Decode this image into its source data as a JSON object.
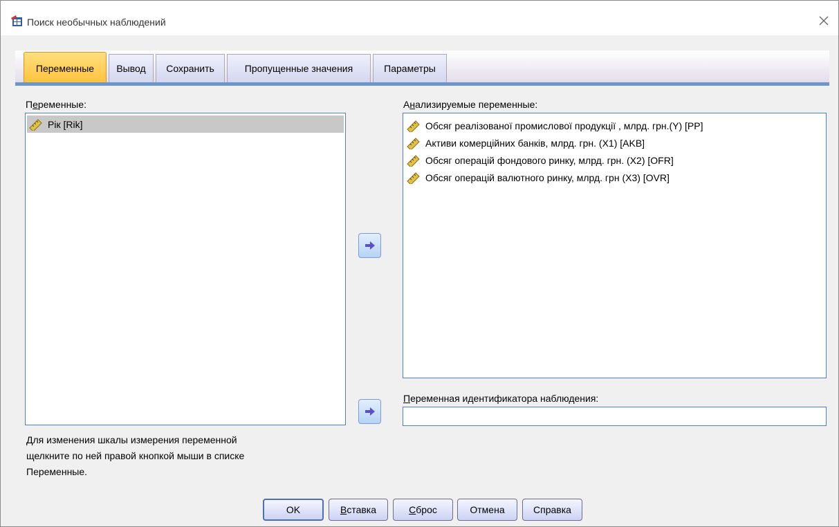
{
  "window": {
    "title": "Поиск необычных наблюдений"
  },
  "tabs": [
    {
      "label": "Переменные",
      "active": true
    },
    {
      "label": "Вывод"
    },
    {
      "label": "Сохранить"
    },
    {
      "label": "Пропущенные значения"
    },
    {
      "label": "Параметры"
    }
  ],
  "source_panel": {
    "label_prefix": "П",
    "label_accel": "е",
    "label_rest": "ременные:",
    "items": [
      "Рік [Rik]"
    ]
  },
  "analysis_panel": {
    "label_prefix": "А",
    "label_accel": "н",
    "label_rest": "ализируемые переменные:",
    "items": [
      "Обсяг реалізованої промислової продукції , млрд. грн.(Y) [PP]",
      "Активи комерційних банків, млрд. грн. (X1) [AKB]",
      "Обсяг операцій фондового ринку, млрд. грн. (X2) [OFR]",
      "Обсяг операцій валютного ринку, млрд. грн (X3) [OVR]"
    ]
  },
  "case_id": {
    "label_accel": "П",
    "label_rest": "еременная идентификатора наблюдения:",
    "value": ""
  },
  "help_text": {
    "line1": "Для изменения шкалы измерения переменной",
    "line2": "щелкните по ней правой кнопкой мыши в списке",
    "line3": "Переменные."
  },
  "buttons": {
    "ok": "OK",
    "paste_accel": "В",
    "paste_rest": "ставка",
    "reset_accel": "С",
    "reset_rest": "брос",
    "cancel": "Отмена",
    "help": "Справка"
  },
  "icons": {
    "app": "spss-dialog-icon",
    "close": "close-icon",
    "scale": "ruler-scale-icon",
    "move": "arrow-right-icon"
  },
  "colors": {
    "active_tab": "#ffc23a",
    "accent_line": "#6d97c9",
    "list_border": "#4f7fbf",
    "selection": "#c8c8c8"
  }
}
